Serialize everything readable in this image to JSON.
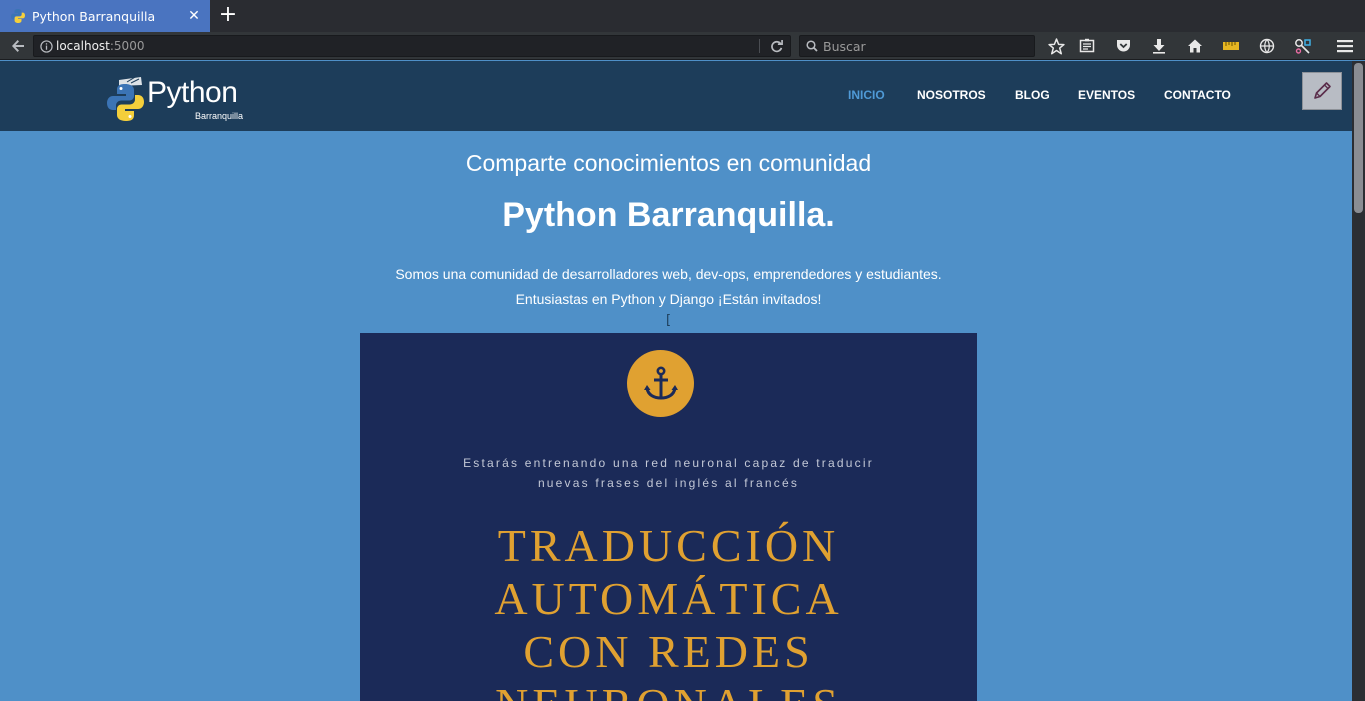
{
  "browser": {
    "tab_title": "Python Barranquilla",
    "url_host": "localhost",
    "url_port": ":5000",
    "search_placeholder": "Buscar"
  },
  "site": {
    "logo_text": "Python",
    "logo_subtext": "Barranquilla",
    "nav": [
      "INICIO",
      "NOSOTROS",
      "BLOG",
      "EVENTOS",
      "CONTACTO"
    ],
    "active_nav": "INICIO"
  },
  "hero": {
    "subtitle": "Comparte conocimientos en comunidad",
    "title": "Python Barranquilla.",
    "description_line1": "Somos una comunidad de desarrolladores web, dev-ops, emprendedores y estudiantes.",
    "description_line2": "Entusiastas en Python y Django ¡Están invitados!",
    "stray_char": "["
  },
  "poster": {
    "tagline_line1": "Estarás entrenando una red neuronal capaz de traducir",
    "tagline_line2": "nuevas frases del inglés al francés",
    "title_line1": "TRADUCCIÓN",
    "title_line2": "AUTOMÁTICA",
    "title_line3": "CON REDES",
    "title_line4": "NEURONALES"
  },
  "colors": {
    "page_bg": "#4f90c8",
    "header_bg": "#1d3d5a",
    "nav_active": "#4f9ad6",
    "poster_bg": "#1b2a58",
    "poster_accent": "#e0a131"
  },
  "icons": [
    "python-favicon-icon",
    "close-icon",
    "plus-icon",
    "back-arrow-icon",
    "info-icon",
    "reload-icon",
    "search-icon",
    "star-icon",
    "reader-icon",
    "pocket-icon",
    "download-icon",
    "home-icon",
    "ruler-icon",
    "globe-icon",
    "extension-icon",
    "menu-icon",
    "pencil-icon",
    "anchor-icon"
  ]
}
